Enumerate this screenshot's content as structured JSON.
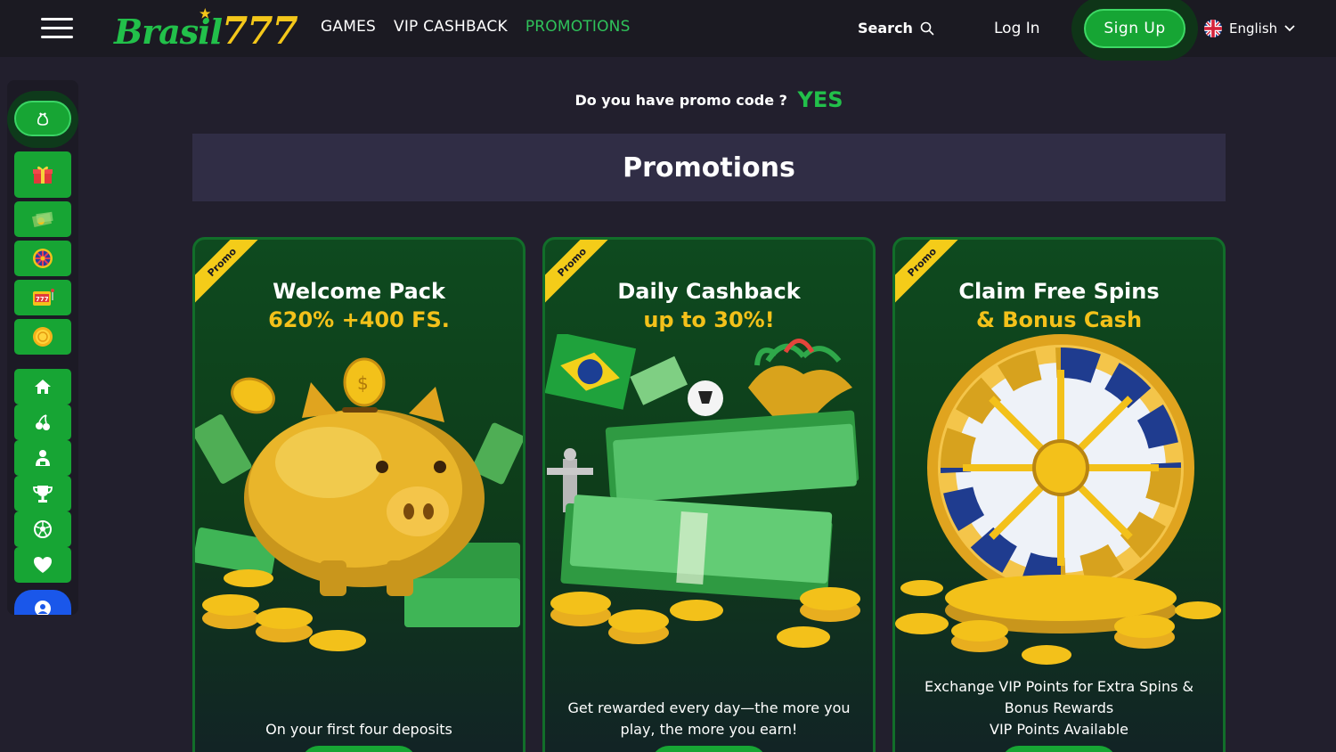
{
  "header": {
    "logo_primary": "Brasil",
    "logo_secondary": "777",
    "nav": [
      {
        "label": "GAMES",
        "active": false
      },
      {
        "label": "VIP CASHBACK",
        "active": false
      },
      {
        "label": "PROMOTIONS",
        "active": true
      }
    ],
    "search_label": "Search",
    "login_label": "Log In",
    "signup_label": "Sign Up",
    "language_label": "English"
  },
  "sidebar": {
    "icons": [
      "bag-icon",
      "gift-icon",
      "cash-icon",
      "wheel-icon",
      "slot-icon",
      "coin-icon",
      "home-icon",
      "cherry-icon",
      "dealer-icon",
      "trophy-icon",
      "soccer-ball-icon",
      "heart-icon",
      "user-icon"
    ]
  },
  "promo_code": {
    "question": "Do you have promo code ?",
    "answer": "YES"
  },
  "page_title": "Promotions",
  "cards": [
    {
      "ribbon": "Promo",
      "title": "Welcome Pack",
      "subtitle": "620% +400 FS.",
      "description": "On your first four deposits",
      "art": "golden-piggy-bank-illustration"
    },
    {
      "ribbon": "Promo",
      "title": "Daily Cashback",
      "subtitle": "up to 30%!",
      "description": "Get rewarded every day—the more you play, the more you earn!",
      "art": "brazil-cash-stacks-illustration"
    },
    {
      "ribbon": "Promo",
      "title": "Claim Free Spins",
      "subtitle": "& Bonus Cash",
      "description_line1": "Exchange VIP Points for Extra Spins & Bonus Rewards",
      "description_line2": "VIP Points Available",
      "art": "golden-prize-wheel-illustration"
    }
  ],
  "colors": {
    "accent_green": "#22c04a",
    "gold": "#f3c11a",
    "background": "#221f2d",
    "banner": "#302d45"
  }
}
